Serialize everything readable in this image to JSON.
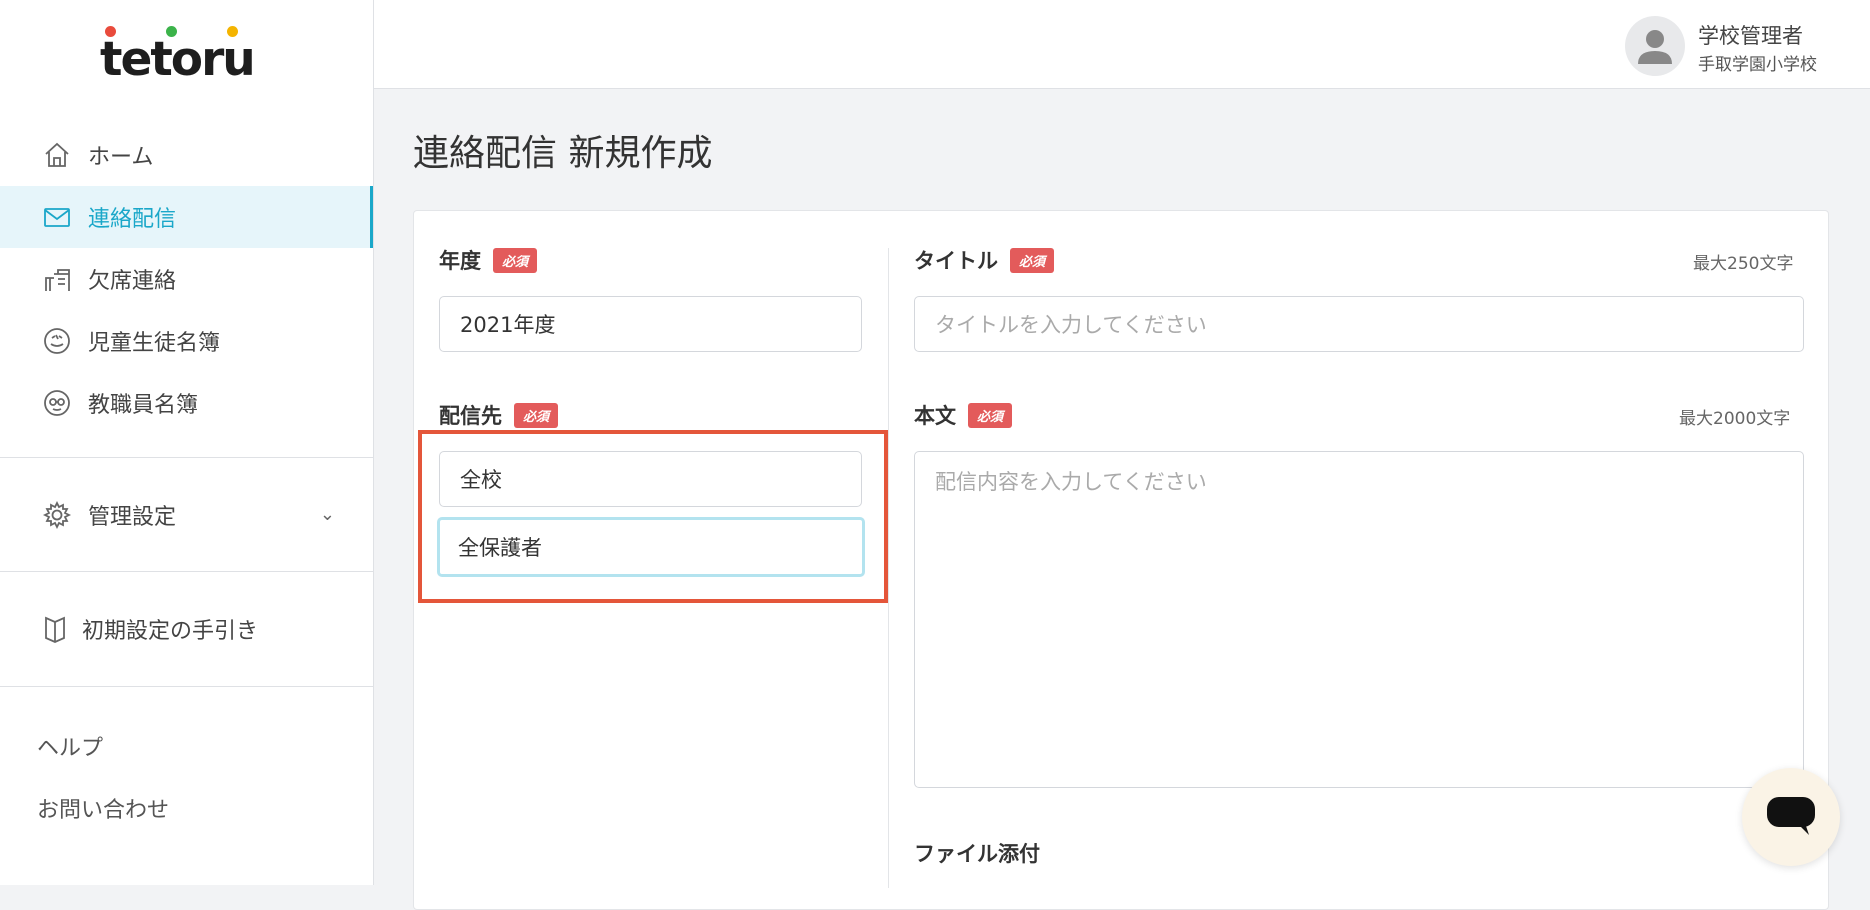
{
  "logo": {
    "text": "tetoru",
    "dot_colors": [
      "#e94b3c",
      "#3bb34a",
      "#f4b400"
    ]
  },
  "sidebar": {
    "nav": [
      {
        "label": "ホーム",
        "icon": "home-icon",
        "active": false
      },
      {
        "label": "連絡配信",
        "icon": "mail-icon",
        "active": true
      },
      {
        "label": "欠席連絡",
        "icon": "desk-icon",
        "active": false
      },
      {
        "label": "児童生徒名簿",
        "icon": "student-face-icon",
        "active": false
      },
      {
        "label": "教職員名簿",
        "icon": "teacher-face-icon",
        "active": false
      }
    ],
    "settings": {
      "label": "管理設定",
      "icon": "gear-icon"
    },
    "guide": {
      "label": "初期設定の手引き",
      "icon": "book-icon"
    },
    "help": "ヘルプ",
    "contact": "お問い合わせ"
  },
  "header": {
    "user_role": "学校管理者",
    "user_school": "手取学園小学校"
  },
  "page": {
    "title": "連絡配信 新規作成"
  },
  "form": {
    "required_badge": "必須",
    "year": {
      "label": "年度",
      "value": "2021年度"
    },
    "recipient": {
      "label": "配信先",
      "values": [
        "全校",
        "全保護者"
      ]
    },
    "title": {
      "label": "タイトル",
      "max": "最大250文字",
      "placeholder": "タイトルを入力してください"
    },
    "body": {
      "label": "本文",
      "max": "最大2000文字",
      "placeholder": "配信内容を入力してください"
    },
    "attachment": {
      "label": "ファイル添付"
    }
  },
  "colors": {
    "accent": "#1aa7c9",
    "required": "#e35b5b",
    "highlight": "#e4563a"
  }
}
